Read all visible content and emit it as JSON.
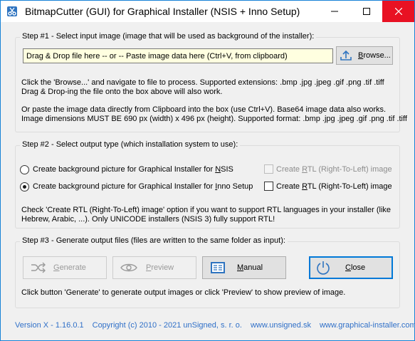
{
  "window": {
    "title": "BitmapCutter (GUI) for Graphical Installer (NSIS + Inno Setup)",
    "close_color": "#e81123"
  },
  "step1": {
    "title": "Step #1 - Select input image (image that will be used as background of the installer):",
    "input_value": "Drag & Drop file here -- or -- Paste image data here (Ctrl+V, from clipboard)",
    "browse_label": "Browse...",
    "browse_pre": "B",
    "browse_post": "rowse...",
    "help1_line1": "Click the 'Browse...' and navigate to file to process. Supported extensions: .bmp .jpg .jpeg .gif .png .tif .tiff",
    "help1_line2": "Drag & Drop-ing the file onto the box above will also work.",
    "help2_line1": "Or paste the image data directly from Clipboard into the box (use Ctrl+V). Base64 image data also works.",
    "help2_line2": "Image dimensions MUST BE 690 px (width) x 496 px (height). Supported format: .bmp .jpg .jpeg .gif .png .tif .tiff"
  },
  "step2": {
    "title": "Step #2 - Select output type (which installation system to use):",
    "radio_nsis_pre": "Create background picture for Graphical Installer for ",
    "radio_nsis_ul": "N",
    "radio_nsis_post": "SIS",
    "radio_nsis_checked": false,
    "radio_inno_pre": "Create background picture for Graphical Installer for ",
    "radio_inno_ul": "I",
    "radio_inno_post": "nno Setup",
    "radio_inno_checked": true,
    "rtl_pre": "Create ",
    "rtl_ul": "R",
    "rtl_post": "TL (Right-To-Left) image",
    "rtl_nsis_checked": false,
    "rtl_nsis_enabled": false,
    "rtl_inno_checked": false,
    "rtl_inno_enabled": true,
    "note_line1": "Check 'Create RTL (Right-To-Left) image' option if you want to support RTL languages in your installer (like",
    "note_line2": "Hebrew, Arabic, ...). Only UNICODE installers (NSIS 3) fully support RTL!"
  },
  "step3": {
    "title": "Step #3 - Generate output files (files are written to the same folder as input):",
    "generate_ul": "G",
    "generate_post": "enerate",
    "preview_ul": "P",
    "preview_post": "review",
    "manual_ul": "M",
    "manual_post": "anual",
    "close_ul": "C",
    "close_post": "lose",
    "generate_icon": "shuffle-icon",
    "preview_icon": "eye-icon",
    "manual_icon": "book-icon",
    "close_icon": "power-icon",
    "help": "Click button 'Generate' to generate output images or click 'Preview' to show preview of image."
  },
  "footer": {
    "version": "Version X - 1.16.0.1",
    "copyright": "Copyright (c)  2010 - 2021 unSigned, s. r. o.",
    "link1": "www.unsigned.sk",
    "link2": "www.graphical-installer.com",
    "link_color": "#3070c8"
  }
}
